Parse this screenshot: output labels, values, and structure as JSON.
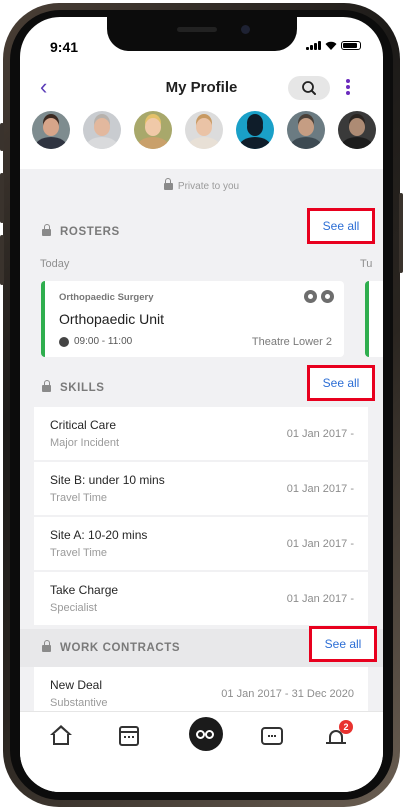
{
  "status_bar": {
    "time": "9:41"
  },
  "header": {
    "back": "‹",
    "title": "My Profile"
  },
  "avatars": [
    {
      "skin": "#d7a58a",
      "hair": "#3b2a21",
      "bg": "#7e8c8f",
      "shirt": "#2f3440"
    },
    {
      "skin": "#e2b89e",
      "hair": "#b7b2ad",
      "bg": "#c9ccd0",
      "shirt": "#d9dadc"
    },
    {
      "skin": "#f0c9a8",
      "hair": "#e4c16a",
      "bg": "#a8a86b",
      "shirt": "#c9a06b"
    },
    {
      "skin": "#eac3a6",
      "hair": "#c89a63",
      "bg": "#dcdcdc",
      "shirt": "#e8e0d6"
    },
    {
      "skin": "#0f1d2a",
      "hair": "#0f1d2a",
      "bg": "#1aa0c8",
      "shirt": "#0f1d2a"
    },
    {
      "skin": "#c59d83",
      "hair": "#4a4038",
      "bg": "#6b7b82",
      "shirt": "#3d4a52"
    },
    {
      "skin": "#ad8b74",
      "hair": "#2a2420",
      "bg": "#3a3a3a",
      "shirt": "#1c1c1c"
    }
  ],
  "private_label": "Private to you",
  "rosters": {
    "title": "ROSTERS",
    "see_all": "See all",
    "today_label": "Today",
    "next_label": "Tu",
    "card": {
      "department": "Orthopaedic Surgery",
      "unit": "Orthopaedic Unit",
      "time": "09:00 - 11:00",
      "location": "Theatre Lower 2"
    }
  },
  "skills": {
    "title": "SKILLS",
    "see_all": "See all",
    "items": [
      {
        "name": "Critical Care",
        "category": "Major Incident",
        "date": "01 Jan 2017 -"
      },
      {
        "name": "Site B: under 10 mins",
        "category": "Travel Time",
        "date": "01 Jan 2017 -"
      },
      {
        "name": "Site A: 10-20 mins",
        "category": "Travel Time",
        "date": "01 Jan 2017 -"
      },
      {
        "name": "Take Charge",
        "category": "Specialist",
        "date": "01 Jan 2017 -"
      }
    ]
  },
  "contracts": {
    "title": "WORK CONTRACTS",
    "see_all": "See all",
    "items": [
      {
        "name": "New Deal",
        "type": "Substantive",
        "dates": "01 Jan 2017 - 31 Dec 2020"
      }
    ]
  },
  "tab_bar": {
    "notification_count": "2"
  },
  "colors": {
    "accent": "#5b3db8",
    "link": "#2c6ed5",
    "highlight": "#e8001e",
    "roster_bar": "#2fae4e",
    "badge": "#e8322f"
  }
}
